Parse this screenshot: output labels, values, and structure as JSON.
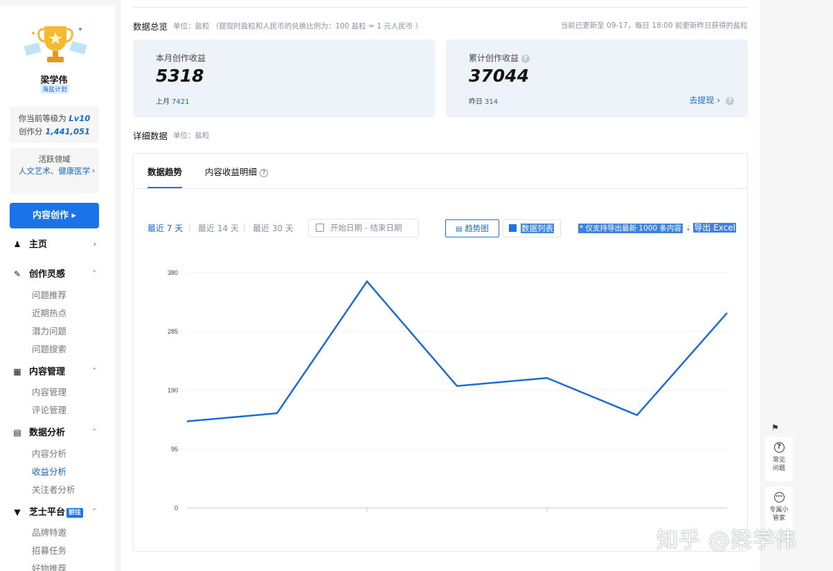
{
  "sidebar": {
    "username": "梁学伟",
    "plan_badge": "海盐计划",
    "level_label": "你当前等级为",
    "level_value": "Lv10",
    "score_label": "创作分",
    "score_value": "1,441,051",
    "domain_label": "活跃领域",
    "domain_value": "人文艺术、健康医学",
    "create_button": "内容创作 ▸",
    "sections": [
      {
        "icon": "user-icon",
        "label": "主页",
        "caret": "›"
      },
      {
        "icon": "pen-icon",
        "label": "创作灵感",
        "caret": "^"
      },
      {
        "icon": "grid-icon",
        "label": "内容管理",
        "caret": "^"
      },
      {
        "icon": "chart-icon",
        "label": "数据分析",
        "caret": "^"
      },
      {
        "icon": "zhishi-icon",
        "label": "芝士平台",
        "badge": "前往",
        "caret": "^"
      }
    ],
    "inspiration_items": [
      "问题推荐",
      "近期热点",
      "潜力问题",
      "问题搜索"
    ],
    "content_items": [
      "内容管理",
      "评论管理"
    ],
    "analysis_items": [
      "内容分析",
      "收益分析",
      "关注者分析"
    ],
    "zhishi_items": [
      "品牌特邀",
      "招募任务",
      "好物推荐"
    ]
  },
  "overview": {
    "title": "数据总览",
    "unit": "单位：盐粒 （提现时盐粒和人民币的兑换比例为：100 盐粒 = 1 元人民币 ）",
    "update_note": "当前已更新至 09-17，每日 18:00 前更新昨日获得的盐粒",
    "monthly": {
      "label": "本月创作收益",
      "value": "5318",
      "sub_label": "上月",
      "sub_value": "7421"
    },
    "total": {
      "label": "累计创作收益",
      "value": "37044",
      "sub_label": "昨日",
      "sub_value": "314",
      "withdraw": "去提现 ›"
    }
  },
  "detail": {
    "title": "详细数据",
    "unit": "单位：盐粒",
    "tabs": [
      "数据趋势",
      "内容收益明细"
    ],
    "ranges": [
      "最近 7 天",
      "最近 14 天",
      "最近 30 天"
    ],
    "date_placeholder": "开始日期  -  结束日期",
    "view_trend": "趋势图",
    "view_list": "数据列表",
    "export_note": "* 仅支持导出最新 1000 条内容",
    "export_button": "导出 Excel"
  },
  "chart_data": {
    "type": "line",
    "y_ticks": [
      "380",
      "285",
      "190",
      "95",
      "0"
    ],
    "ylim": [
      0,
      380
    ],
    "x": [
      1,
      2,
      3,
      4,
      5,
      6,
      7
    ],
    "values": [
      140,
      153,
      366,
      197,
      210,
      150,
      315
    ],
    "line_color": "#1a6bd6",
    "grid": true
  },
  "float": {
    "faq": "常见问题",
    "assistant": "专属小管家"
  },
  "watermark": "知乎 @梁学伟"
}
